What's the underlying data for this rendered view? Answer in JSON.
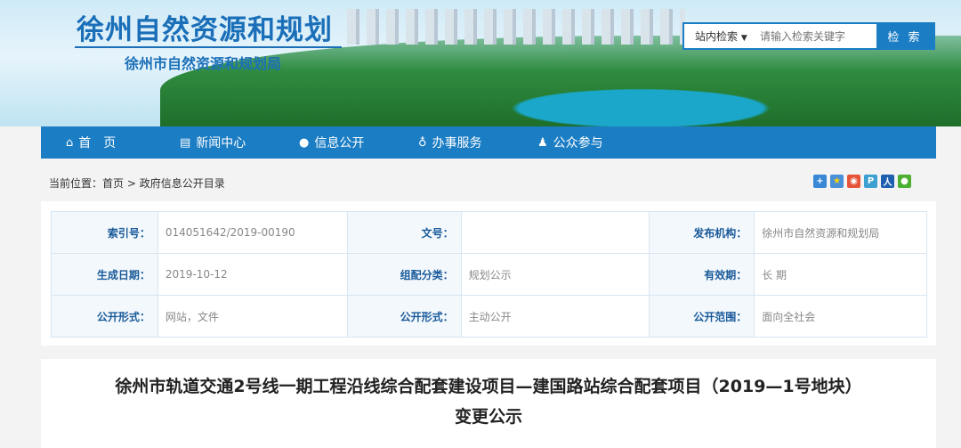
{
  "header": {
    "logo_title": "徐州自然资源和规划",
    "logo_subtitle": "徐州市自然资源和规划局"
  },
  "search": {
    "scope": "站内检索",
    "scope_arrow": "▼",
    "placeholder": "请输入检索关键字",
    "button": "检 索"
  },
  "nav": [
    {
      "label": "首　页",
      "icon": "home-icon"
    },
    {
      "label": "新闻中心",
      "icon": "newspaper-icon"
    },
    {
      "label": "信息公开",
      "icon": "globe-icon"
    },
    {
      "label": "办事服务",
      "icon": "thumbs-up-icon"
    },
    {
      "label": "公众参与",
      "icon": "user-icon"
    }
  ],
  "breadcrumb": {
    "prefix": "当前位置：",
    "home": "首页",
    "sep": " > ",
    "current": "政府信息公开目录"
  },
  "share_icons": [
    "plus-share-icon",
    "qzone-icon",
    "weibo-icon",
    "tencent-weibo-icon",
    "renren-icon",
    "wechat-icon"
  ],
  "info": [
    [
      {
        "label": "索引号：",
        "value": "014051642/2019-00190"
      },
      {
        "label": "文号：",
        "value": ""
      },
      {
        "label": "发布机构：",
        "value": "徐州市自然资源和规划局"
      }
    ],
    [
      {
        "label": "生成日期：",
        "value": "2019-10-12"
      },
      {
        "label": "组配分类：",
        "value": "规划公示"
      },
      {
        "label": "有效期：",
        "value": "长 期"
      }
    ],
    [
      {
        "label": "公开形式：",
        "value": "网站，文件"
      },
      {
        "label": "公开形式：",
        "value": "主动公开"
      },
      {
        "label": "公开范围：",
        "value": "面向全社会"
      }
    ]
  ],
  "article": {
    "title_line1": "徐州市轨道交通2号线一期工程沿线综合配套建设项目—建国路站综合配套项目（2019—1号地块）",
    "title_line2": "变更公示"
  }
}
